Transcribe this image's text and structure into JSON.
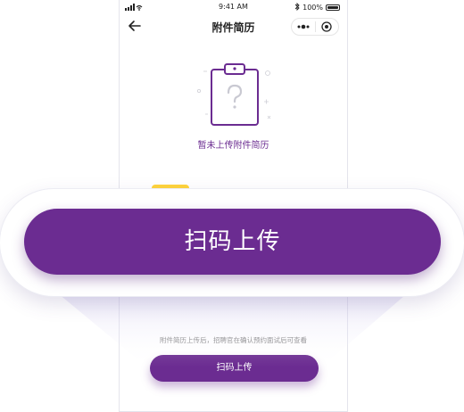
{
  "status_bar": {
    "time": "9:41 AM",
    "battery": "100%"
  },
  "nav": {
    "title": "附件简历"
  },
  "empty_state": {
    "text": "暂未上传附件简历"
  },
  "hint": "附件简历上传后，招聘官在确认预约面试后可查看",
  "button": {
    "label": "扫码上传"
  },
  "colors": {
    "accent": "#6b2c91",
    "highlight": "#ffd43b"
  }
}
